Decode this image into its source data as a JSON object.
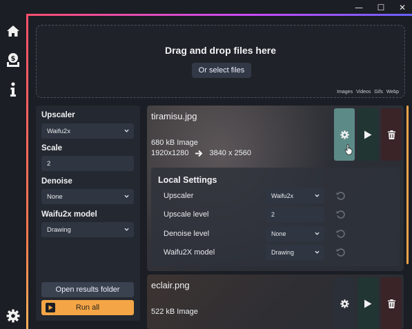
{
  "window": {
    "minimize_glyph": "—",
    "maximize_glyph": "☐",
    "close_glyph": "✕"
  },
  "rail": {
    "icons": [
      "home-icon",
      "money-bag-icon",
      "info-icon",
      "gear-icon"
    ]
  },
  "dropzone": {
    "title": "Drag and drop files here",
    "select_label": "Or select files",
    "formats": [
      "Images",
      "Videos",
      "Gifs",
      "Webp"
    ]
  },
  "settings": {
    "upscaler_label": "Upscaler",
    "upscaler_value": "Waifu2x",
    "scale_label": "Scale",
    "scale_value": "2",
    "denoise_label": "Denoise",
    "denoise_value": "None",
    "model_label": "Waifu2x model",
    "model_value": "Drawing",
    "open_results_label": "Open results folder",
    "run_all_label": "Run all"
  },
  "files": [
    {
      "name": "tiramisu.jpg",
      "size_type": "680 kB  Image",
      "from_res": "1920x1280",
      "to_res": "3840 x 2560",
      "local": {
        "title": "Local Settings",
        "upscaler_label": "Upscaler",
        "upscaler_value": "Waifu2x",
        "level_label": "Upscale level",
        "level_value": "2",
        "denoise_label": "Denoise level",
        "denoise_value": "None",
        "model_label": "Waifu2X model",
        "model_value": "Drawing"
      }
    },
    {
      "name": "eclair.png",
      "size_type": "522 kB  Image"
    }
  ],
  "colors": {
    "accent_orange": "#f4a545",
    "settings_active": "#5c8a87",
    "play_bg": "#213533",
    "delete_bg": "#3a2428"
  }
}
